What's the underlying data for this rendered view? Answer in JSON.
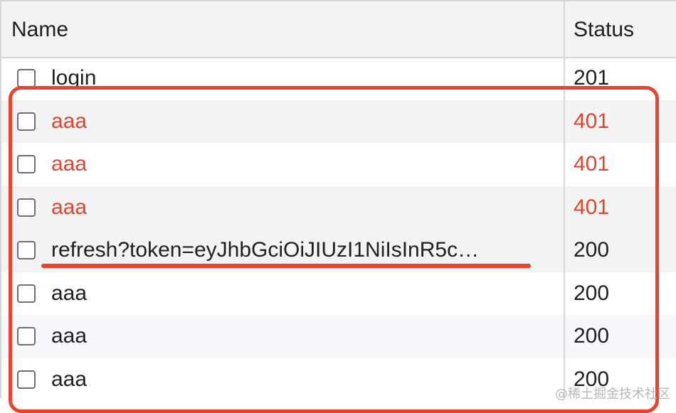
{
  "columns": {
    "name": "Name",
    "status": "Status"
  },
  "rows": [
    {
      "name": "login",
      "status": "201",
      "error": false
    },
    {
      "name": "aaa",
      "status": "401",
      "error": true
    },
    {
      "name": "aaa",
      "status": "401",
      "error": true
    },
    {
      "name": "aaa",
      "status": "401",
      "error": true
    },
    {
      "name": "refresh?token=eyJhbGciOiJIUzI1NiIsInR5c…",
      "status": "200",
      "error": false
    },
    {
      "name": "aaa",
      "status": "200",
      "error": false
    },
    {
      "name": "aaa",
      "status": "200",
      "error": false
    },
    {
      "name": "aaa",
      "status": "200",
      "error": false
    }
  ],
  "watermark": "@稀土掘金技术社区",
  "colors": {
    "error": "#e2452f",
    "annotation": "#e8432e"
  }
}
